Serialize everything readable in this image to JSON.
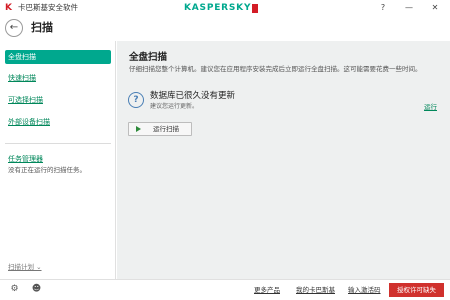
{
  "window": {
    "app_title": "卡巴斯基安全软件",
    "brand": "KASPERSKY",
    "help_glyph": "?",
    "minimize_glyph": "—",
    "close_glyph": "✕"
  },
  "header": {
    "back_glyph": "←",
    "title": "扫描"
  },
  "sidebar": {
    "items": [
      {
        "label": "全盘扫描",
        "active": true
      },
      {
        "label": "快速扫描",
        "active": false
      },
      {
        "label": "可选择扫描",
        "active": false
      },
      {
        "label": "外部设备扫描",
        "active": false
      }
    ],
    "task_manager": "任务管理器",
    "task_status": "没有正在运行的扫描任务。",
    "schedule": "扫描计划 ⌄"
  },
  "main": {
    "title": "全盘扫描",
    "description": "仔细扫描您整个计算机。建议您在应用程序安装完成后立即运行全盘扫描。这可能需要花费一些时间。",
    "status_title": "数据库已很久没有更新",
    "status_sub": "建议您运行更新。",
    "run_link": "运行",
    "run_button": "运行扫描"
  },
  "footer": {
    "settings_glyph": "⚙",
    "support_glyph": "☻",
    "links": [
      "更多产品",
      "我的卡巴斯基",
      "输入激活码"
    ],
    "license_button": "授权许可缺失"
  },
  "colors": {
    "accent": "#00a88e",
    "link": "#00875a",
    "danger": "#d0312d",
    "main_bg": "#eef0f0"
  }
}
